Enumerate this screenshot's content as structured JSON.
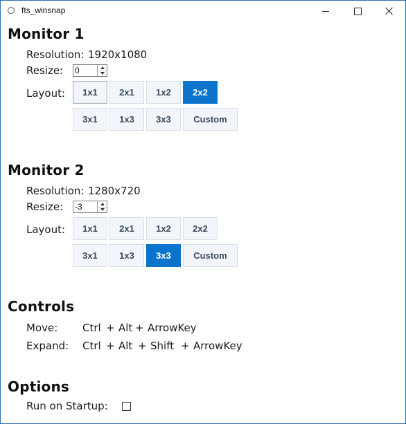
{
  "window": {
    "title": "fts_winsnap",
    "icon": "app-circle-icon",
    "controls": [
      "minimize-icon",
      "maximize-icon",
      "close-icon"
    ]
  },
  "monitor1": {
    "title": "Monitor 1",
    "resolution_label": "Resolution:",
    "resolution_value": "1920x1080",
    "resize_label": "Resize:",
    "resize_value": "0",
    "layout_label": "Layout:",
    "layouts": [
      "1x1",
      "2x1",
      "1x2",
      "2x2",
      "3x1",
      "1x3",
      "3x3",
      "Custom"
    ],
    "selected": "2x2"
  },
  "monitor2": {
    "title": "Monitor 2",
    "resolution_label": "Resolution:",
    "resolution_value": "1280x720",
    "resize_label": "Resize:",
    "resize_value": "-3",
    "layout_label": "Layout:",
    "layouts": [
      "1x1",
      "2x1",
      "1x2",
      "2x2",
      "3x1",
      "1x3",
      "3x3",
      "Custom"
    ],
    "selected": "3x3"
  },
  "controls": {
    "title": "Controls",
    "move_label": "Move:",
    "move_keys": [
      "Ctrl",
      "+",
      "Alt",
      "+",
      "ArrowKey"
    ],
    "expand_label": "Expand:",
    "expand_keys": [
      "Ctrl",
      "+",
      "Alt",
      "+",
      "Shift",
      "+",
      "ArrowKey"
    ]
  },
  "options": {
    "title": "Options",
    "run_on_startup_label": "Run on Startup:",
    "run_on_startup_checked": false
  },
  "colors": {
    "accent": "#0a73cc",
    "button_bg": "#f2f6fa",
    "window_border": "#2b6cb0"
  }
}
